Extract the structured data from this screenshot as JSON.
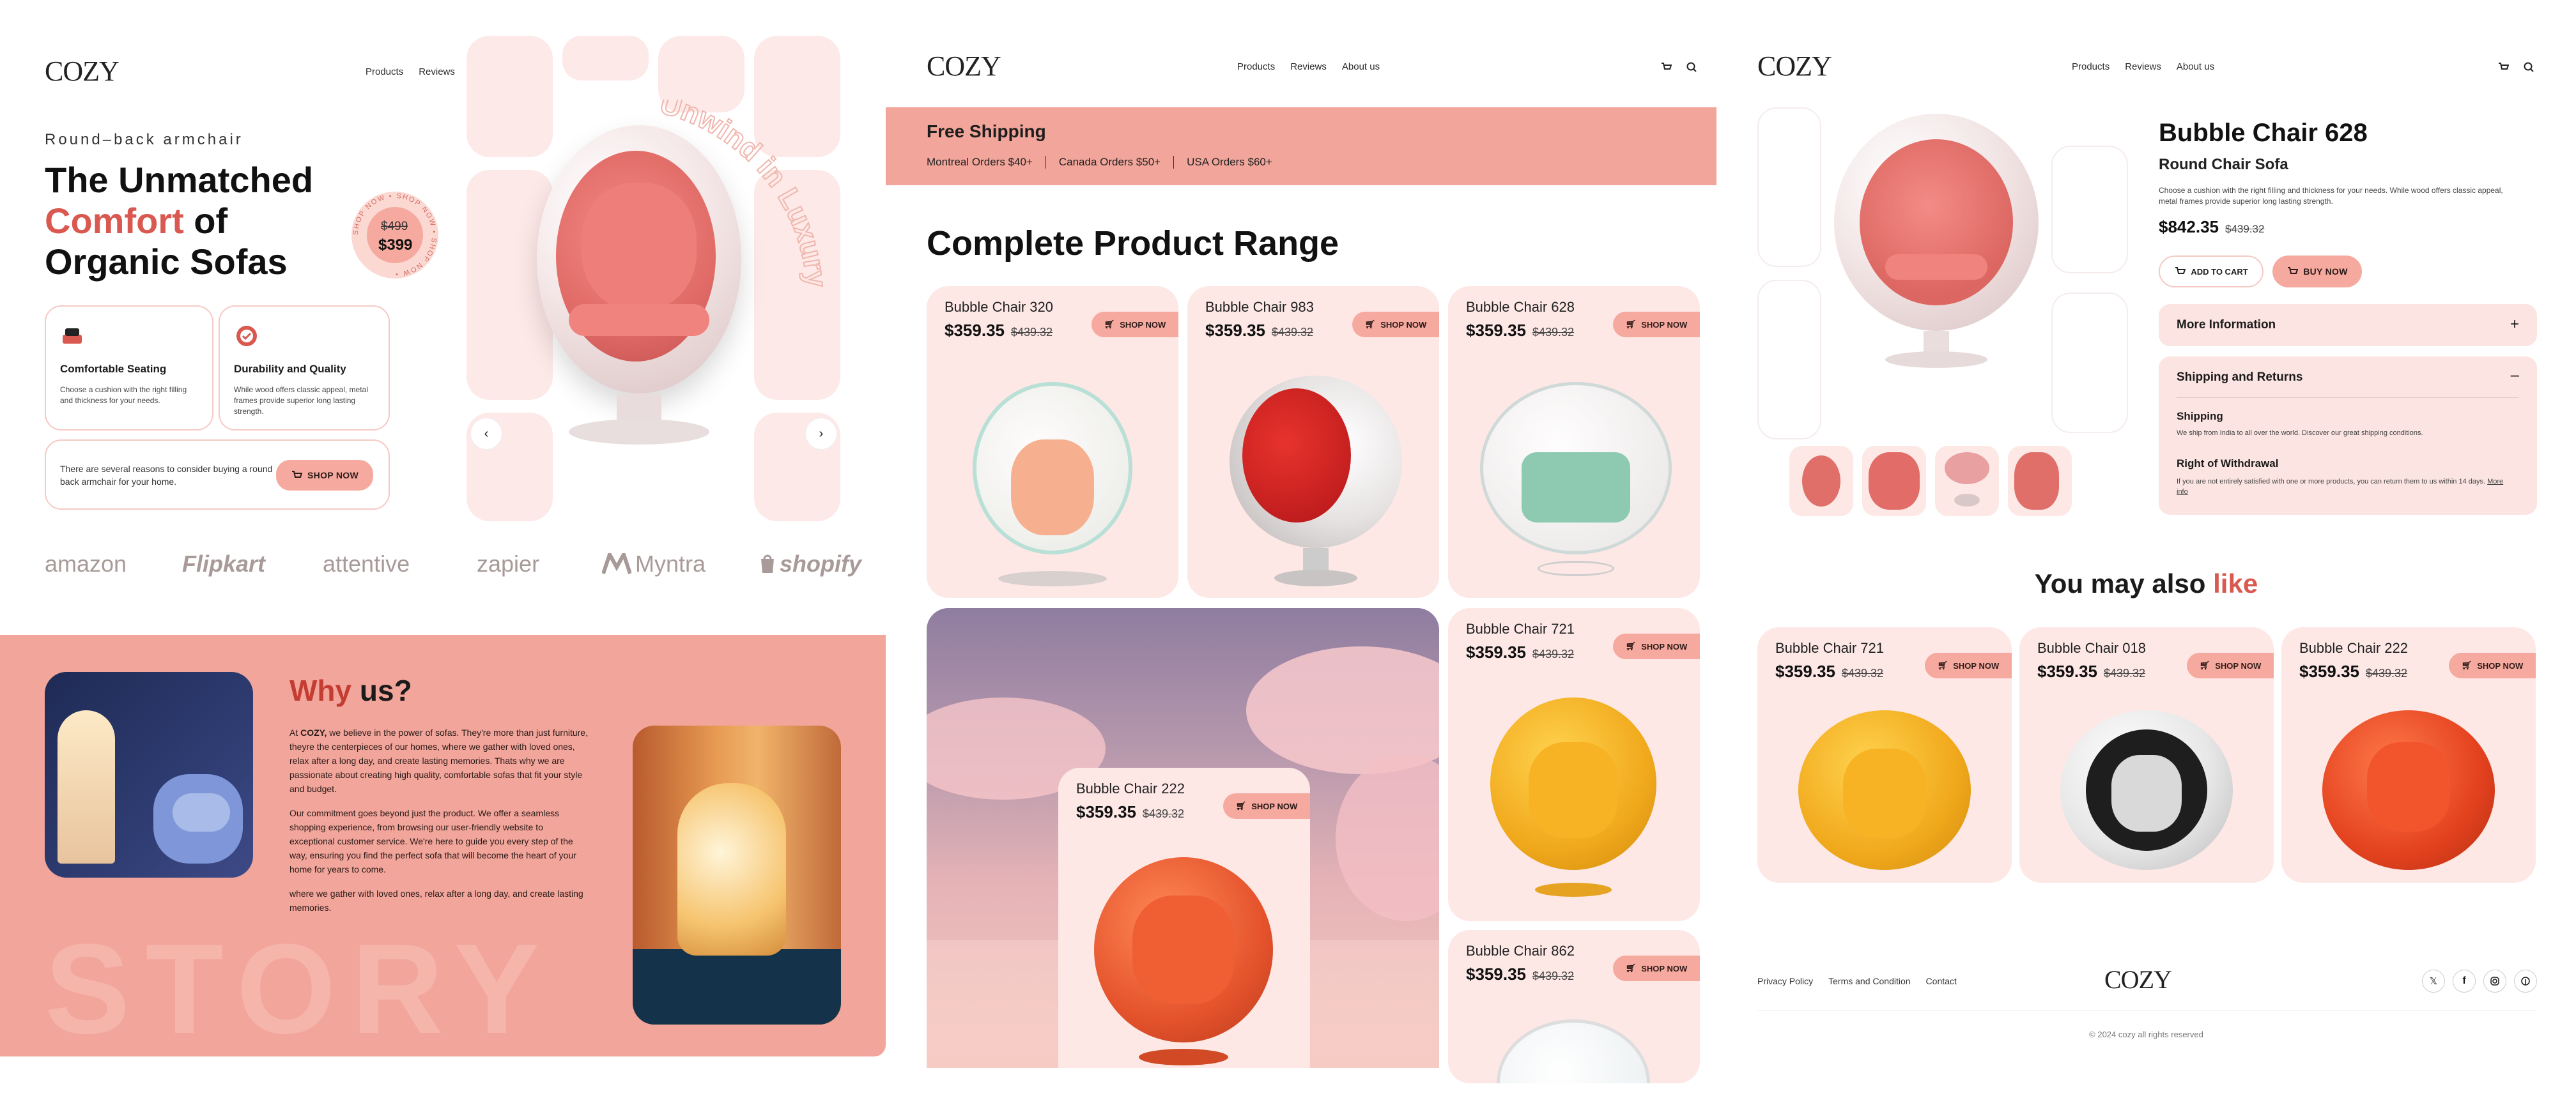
{
  "brand": {
    "logo": "COZY"
  },
  "nav": {
    "products": "Products",
    "reviews": "Reviews",
    "about": "About us"
  },
  "hero": {
    "eyebrow": "Round–back armchair",
    "title_line1": "The Unmatched",
    "title_comfort": "Comfort",
    "title_of": " of",
    "title_line3": "Organic Sofas",
    "badge_old": "$499",
    "badge_new": "$399",
    "badge_ring": "SHOP NOW • SHOP NOW • SHOP NOW •",
    "curved_text": "Unwind in Luxury",
    "feature1_title": "Comfortable Seating",
    "feature1_text": "Choose a cushion with the right filling and thickness for your needs.",
    "feature2_title": "Durability and Quality",
    "feature2_text": "While wood offers classic appeal, metal frames provide superior long lasting strength.",
    "cta_text": "There are several reasons to consider buying a round back armchair for your home.",
    "cta_button": "SHOP NOW"
  },
  "brands": [
    "amazon",
    "Flipkart",
    "attentive",
    "zapier",
    "Myntra",
    "shopify"
  ],
  "why": {
    "title_why": "Why",
    "title_us": " us?",
    "p1_brand": "COZY,",
    "p1_pre": "At ",
    "p1_rest": " we believe in the power of sofas. They're more than just furniture, theyre the centerpieces of our homes, where we gather with loved ones, relax after a long day, and create lasting memories. Thats why we are passionate about creating high quality, comfortable sofas that fit your style and budget.",
    "p2": "Our commitment goes beyond just the product. We offer a seamless shopping experience, from browsing our user-friendly website to exceptional customer service. We're here to guide you every step of the way, ensuring you find the perfect sofa that will become the heart of your home for years to come.",
    "p3": " where we gather with loved ones, relax after a long day, and create lasting memories.",
    "watermark": "STORY"
  },
  "shipping": {
    "title": "Free Shipping",
    "items": [
      "Montreal Orders $40+",
      "Canada Orders $50+",
      "USA Orders $60+"
    ]
  },
  "range": {
    "title": "Complete Product Range",
    "shop_label": "SHOP NOW",
    "products": [
      {
        "name": "Bubble Chair 320",
        "price": "$359.35",
        "old": "$439.32"
      },
      {
        "name": "Bubble Chair 983",
        "price": "$359.35",
        "old": "$439.32"
      },
      {
        "name": "Bubble Chair 628",
        "price": "$359.35",
        "old": "$439.32"
      },
      {
        "name": "Bubble Chair 721",
        "price": "$359.35",
        "old": "$439.32"
      },
      {
        "name": "Bubble Chair 222",
        "price": "$359.35",
        "old": "$439.32"
      },
      {
        "name": "Bubble Chair 862",
        "price": "$359.35",
        "old": "$439.32"
      }
    ]
  },
  "detail": {
    "title": "Bubble Chair 628",
    "subtitle": "Round Chair Sofa",
    "desc": "Choose a cushion with the right filling and thickness for your needs. While wood offers classic appeal, metal frames provide superior long lasting strength.",
    "price": "$842.35",
    "old": "$439.32",
    "add_to_cart": "ADD TO CART",
    "buy_now": "BUY NOW",
    "more_info": "More Information",
    "plus": "+",
    "shipping_returns": "Shipping and Returns",
    "minus": "–",
    "shipping_h": "Shipping",
    "shipping_p": "We ship from India to all over the world. Discover our great shipping conditions.",
    "withdraw_h": "Right of Withdrawal",
    "withdraw_p": "If you are not entirely satisfied with one or more products, you can return them to us within 14 days.",
    "more_link": "More info"
  },
  "also": {
    "title_a": "You may also ",
    "title_like": "like",
    "products": [
      {
        "name": "Bubble Chair 721",
        "price": "$359.35",
        "old": "$439.32"
      },
      {
        "name": "Bubble Chair 018",
        "price": "$359.35",
        "old": "$439.32"
      },
      {
        "name": "Bubble Chair 222",
        "price": "$359.35",
        "old": "$439.32"
      }
    ]
  },
  "footer": {
    "privacy": "Privacy Policy",
    "terms": "Terms and Condition",
    "contact": "Contact",
    "copyright": "© 2024 cozy all rights reserved",
    "socials": [
      "x-icon",
      "facebook-icon",
      "instagram-icon",
      "pinterest-icon"
    ]
  },
  "colors": {
    "accent": "#d9584f",
    "pill": "#f6a99e",
    "card": "#fde8e6",
    "salmon": "#f2a59a"
  }
}
